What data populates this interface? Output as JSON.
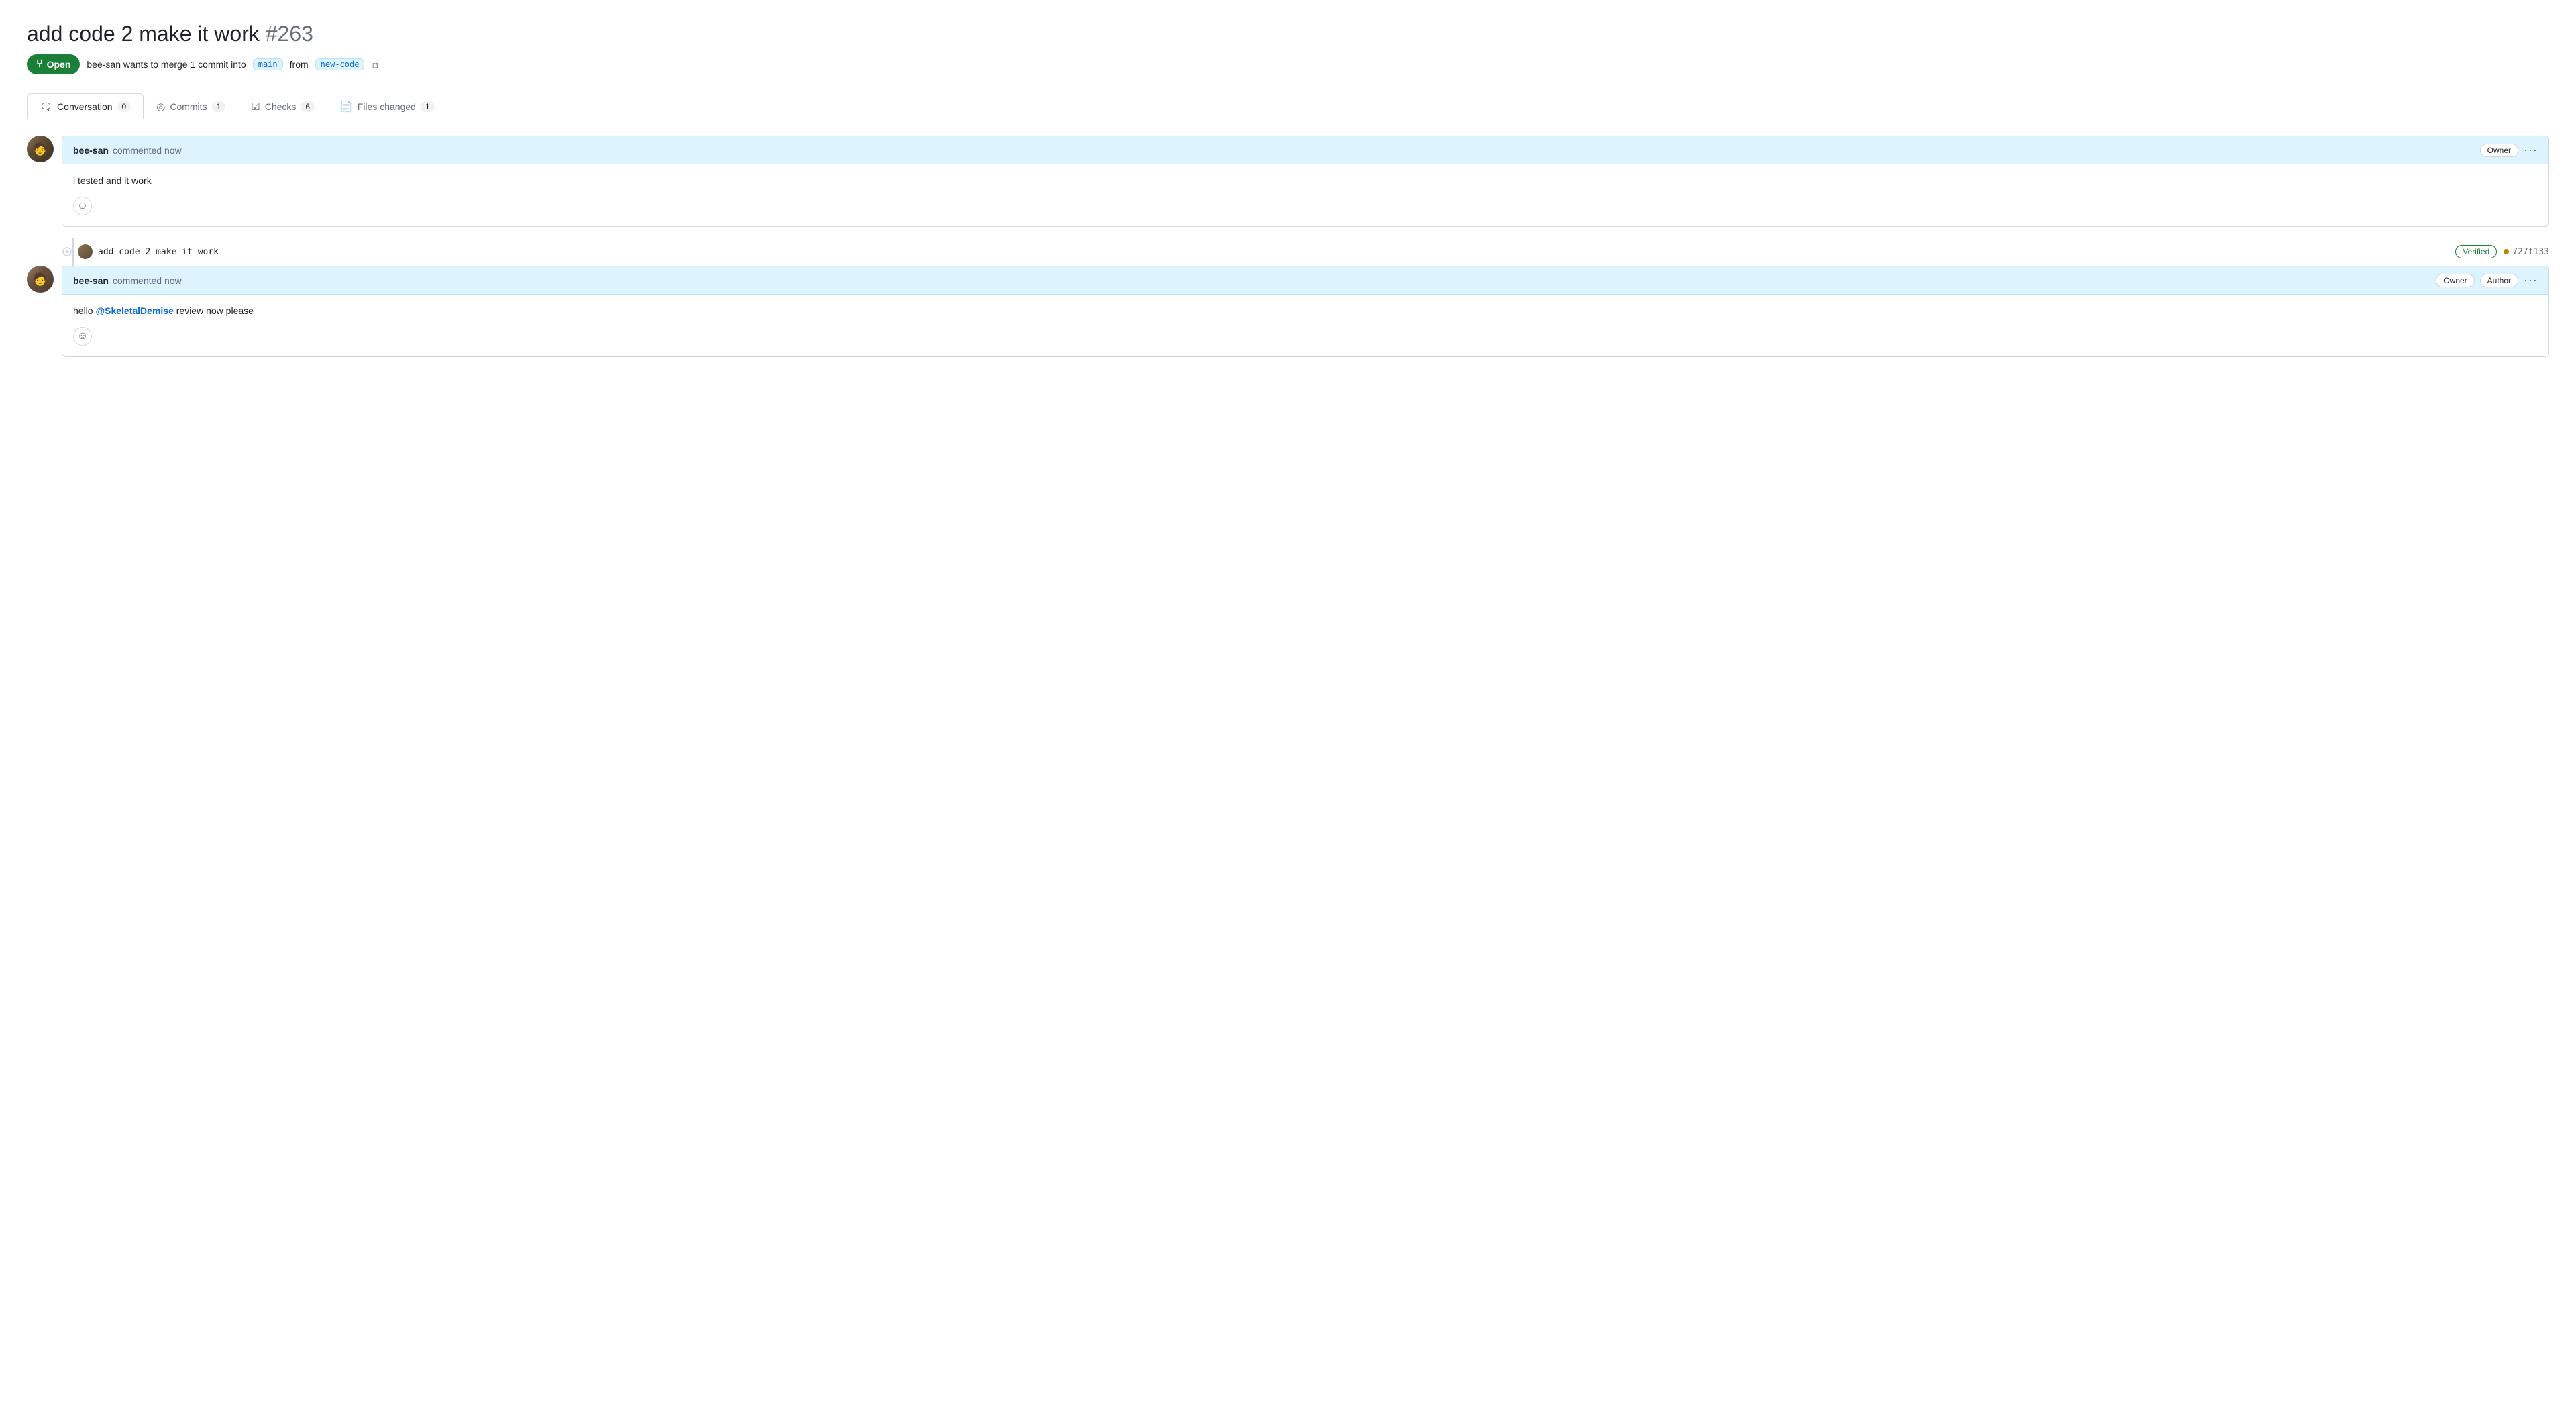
{
  "pr": {
    "title": "add code 2 make it work",
    "number": "#263",
    "status": "Open",
    "subtitle": "bee-san wants to merge 1 commit into",
    "base_branch": "main",
    "head_branch": "new-code"
  },
  "tabs": [
    {
      "id": "conversation",
      "label": "Conversation",
      "count": "0",
      "active": true
    },
    {
      "id": "commits",
      "label": "Commits",
      "count": "1",
      "active": false
    },
    {
      "id": "checks",
      "label": "Checks",
      "count": "6",
      "active": false
    },
    {
      "id": "files-changed",
      "label": "Files changed",
      "count": "1",
      "active": false
    }
  ],
  "comments": [
    {
      "id": "comment-1",
      "author": "bee-san",
      "time": "commented now",
      "badges": [
        "Owner"
      ],
      "body": "i tested and it work",
      "avatar": "1"
    },
    {
      "id": "comment-2",
      "author": "bee-san",
      "time": "commented now",
      "badges": [
        "Owner",
        "Author"
      ],
      "body": "hello @SkeletalDemise review now please",
      "mention": "@SkeletalDemise",
      "avatar": "2"
    }
  ],
  "commit": {
    "message": "add code 2 make it work",
    "verified": "Verified",
    "hash": "727f133"
  },
  "icons": {
    "open_pr": "⑂",
    "conversation": "💬",
    "commits": "◎",
    "checks": "☑",
    "files_changed": "📄",
    "emoji": "☺",
    "more": "···",
    "copy": "⧉"
  }
}
